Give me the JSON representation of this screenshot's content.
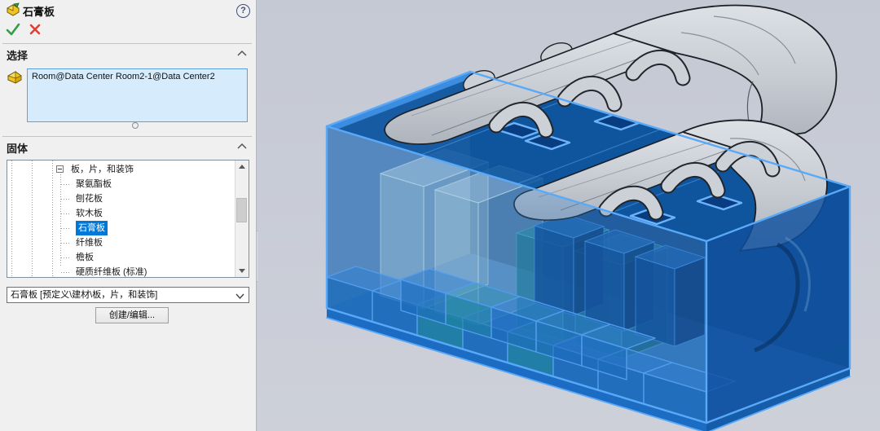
{
  "panel": {
    "title": "石膏板",
    "help": "?",
    "sections": {
      "selection": "选择",
      "solid": "固体"
    },
    "selection_box": {
      "value": "Room@Data Center Room2-1@Data Center2"
    },
    "tree": {
      "root_label": "板，片，和装饰",
      "items": [
        "聚氨酯板",
        "刨花板",
        "软木板",
        "石膏板",
        "纤维板",
        "檐板",
        "硬质纤维板 (标准)"
      ],
      "selected_item": "石膏板"
    },
    "material_select": {
      "value": "石膏板 [预定义\\建材\\板，片，和装饰]"
    },
    "create_edit_button": "创建/编辑..."
  },
  "icons": {
    "title_icon": "solid-body-icon",
    "selection_icon": "select-pointer-icon",
    "confirm": "check-icon",
    "cancel": "close-icon",
    "help": "help-icon",
    "collapse": "chevron-up-icon",
    "dropdown": "chevron-down-icon"
  },
  "colors": {
    "accent": "#0078d7",
    "selection_fill": "#d6ecfc",
    "edge_highlight": "#5aa9f8",
    "room_blue": "#1565b5",
    "roof_blue": "#0d55a0",
    "duct_gray": "#ccd1d8",
    "viewport_bg": "#c7cbd5",
    "panel_bg": "#f0f0f0",
    "confirm_green": "#2f9e44",
    "cancel_red": "#e04034"
  }
}
